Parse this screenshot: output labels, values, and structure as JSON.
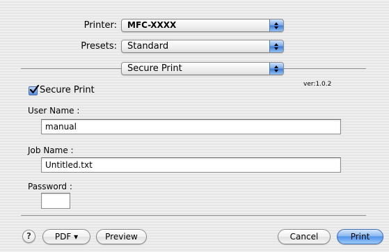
{
  "printer": {
    "label": "Printer:",
    "value": "MFC-XXXX"
  },
  "presets": {
    "label": "Presets:",
    "value": "Standard"
  },
  "panel_menu": {
    "value": "Secure Print"
  },
  "secure_print": {
    "checkbox_label": "Secure Print",
    "checked": true,
    "version": "ver:1.0.2",
    "user_name": {
      "label": "User Name :",
      "value": "manual"
    },
    "job_name": {
      "label": "Job Name :",
      "value": "Untitled.txt"
    },
    "password": {
      "label": "Password :",
      "value": ""
    }
  },
  "footer": {
    "help": "?",
    "pdf": "PDF ▾",
    "preview": "Preview",
    "cancel": "Cancel",
    "print": "Print"
  }
}
